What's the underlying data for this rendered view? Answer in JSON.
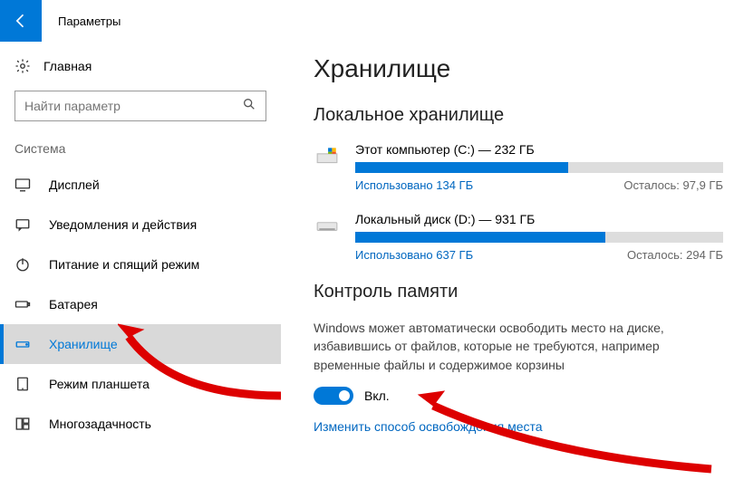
{
  "window_title": "Параметры",
  "home_label": "Главная",
  "search_placeholder": "Найти параметр",
  "system_section": "Система",
  "nav": {
    "display": "Дисплей",
    "notifications": "Уведомления и действия",
    "power": "Питание и спящий режим",
    "battery": "Батарея",
    "storage": "Хранилище",
    "tablet": "Режим планшета",
    "multitask": "Многозадачность"
  },
  "main": {
    "title": "Хранилище",
    "local_storage": "Локальное хранилище",
    "drives": [
      {
        "name": "Этот компьютер (C:) — 232 ГБ",
        "used": "Использовано 134 ГБ",
        "free": "Осталось: 97,9 ГБ",
        "pct": 58
      },
      {
        "name": "Локальный диск (D:) — 931 ГБ",
        "used": "Использовано 637 ГБ",
        "free": "Осталось: 294 ГБ",
        "pct": 68
      }
    ],
    "sense_title": "Контроль памяти",
    "sense_desc": "Windows может автоматически освободить место на диске, избавившись от файлов, которые не требуются, например временные файлы и содержимое корзины",
    "sense_state": "Вкл.",
    "sense_link": "Изменить способ освобождения места"
  }
}
